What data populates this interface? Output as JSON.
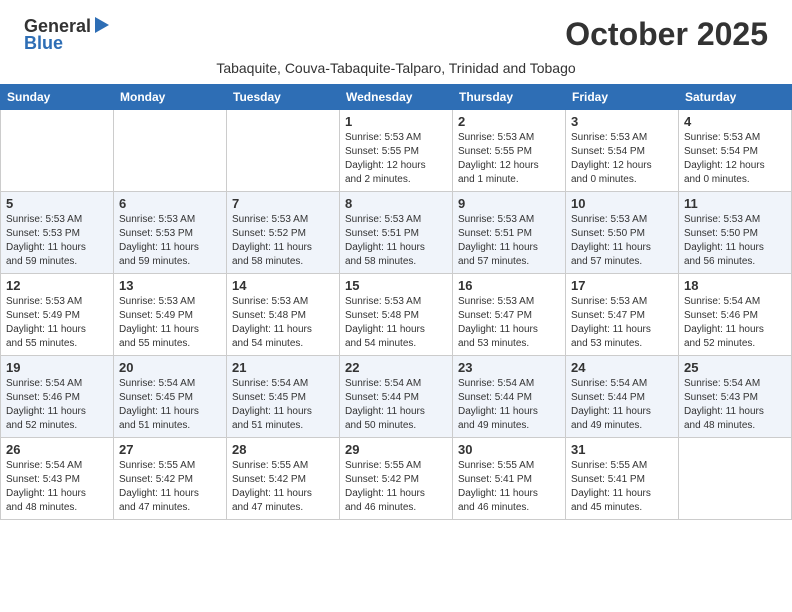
{
  "logo": {
    "general": "General",
    "blue": "Blue",
    "triangle": "▶"
  },
  "title": "October 2025",
  "subtitle": "Tabaquite, Couva-Tabaquite-Talparo, Trinidad and Tobago",
  "days_of_week": [
    "Sunday",
    "Monday",
    "Tuesday",
    "Wednesday",
    "Thursday",
    "Friday",
    "Saturday"
  ],
  "weeks": [
    {
      "cells": [
        {
          "day": "",
          "info": ""
        },
        {
          "day": "",
          "info": ""
        },
        {
          "day": "",
          "info": ""
        },
        {
          "day": "1",
          "info": "Sunrise: 5:53 AM\nSunset: 5:55 PM\nDaylight: 12 hours\nand 2 minutes."
        },
        {
          "day": "2",
          "info": "Sunrise: 5:53 AM\nSunset: 5:55 PM\nDaylight: 12 hours\nand 1 minute."
        },
        {
          "day": "3",
          "info": "Sunrise: 5:53 AM\nSunset: 5:54 PM\nDaylight: 12 hours\nand 0 minutes."
        },
        {
          "day": "4",
          "info": "Sunrise: 5:53 AM\nSunset: 5:54 PM\nDaylight: 12 hours\nand 0 minutes."
        }
      ]
    },
    {
      "cells": [
        {
          "day": "5",
          "info": "Sunrise: 5:53 AM\nSunset: 5:53 PM\nDaylight: 11 hours\nand 59 minutes."
        },
        {
          "day": "6",
          "info": "Sunrise: 5:53 AM\nSunset: 5:53 PM\nDaylight: 11 hours\nand 59 minutes."
        },
        {
          "day": "7",
          "info": "Sunrise: 5:53 AM\nSunset: 5:52 PM\nDaylight: 11 hours\nand 58 minutes."
        },
        {
          "day": "8",
          "info": "Sunrise: 5:53 AM\nSunset: 5:51 PM\nDaylight: 11 hours\nand 58 minutes."
        },
        {
          "day": "9",
          "info": "Sunrise: 5:53 AM\nSunset: 5:51 PM\nDaylight: 11 hours\nand 57 minutes."
        },
        {
          "day": "10",
          "info": "Sunrise: 5:53 AM\nSunset: 5:50 PM\nDaylight: 11 hours\nand 57 minutes."
        },
        {
          "day": "11",
          "info": "Sunrise: 5:53 AM\nSunset: 5:50 PM\nDaylight: 11 hours\nand 56 minutes."
        }
      ]
    },
    {
      "cells": [
        {
          "day": "12",
          "info": "Sunrise: 5:53 AM\nSunset: 5:49 PM\nDaylight: 11 hours\nand 55 minutes."
        },
        {
          "day": "13",
          "info": "Sunrise: 5:53 AM\nSunset: 5:49 PM\nDaylight: 11 hours\nand 55 minutes."
        },
        {
          "day": "14",
          "info": "Sunrise: 5:53 AM\nSunset: 5:48 PM\nDaylight: 11 hours\nand 54 minutes."
        },
        {
          "day": "15",
          "info": "Sunrise: 5:53 AM\nSunset: 5:48 PM\nDaylight: 11 hours\nand 54 minutes."
        },
        {
          "day": "16",
          "info": "Sunrise: 5:53 AM\nSunset: 5:47 PM\nDaylight: 11 hours\nand 53 minutes."
        },
        {
          "day": "17",
          "info": "Sunrise: 5:53 AM\nSunset: 5:47 PM\nDaylight: 11 hours\nand 53 minutes."
        },
        {
          "day": "18",
          "info": "Sunrise: 5:54 AM\nSunset: 5:46 PM\nDaylight: 11 hours\nand 52 minutes."
        }
      ]
    },
    {
      "cells": [
        {
          "day": "19",
          "info": "Sunrise: 5:54 AM\nSunset: 5:46 PM\nDaylight: 11 hours\nand 52 minutes."
        },
        {
          "day": "20",
          "info": "Sunrise: 5:54 AM\nSunset: 5:45 PM\nDaylight: 11 hours\nand 51 minutes."
        },
        {
          "day": "21",
          "info": "Sunrise: 5:54 AM\nSunset: 5:45 PM\nDaylight: 11 hours\nand 51 minutes."
        },
        {
          "day": "22",
          "info": "Sunrise: 5:54 AM\nSunset: 5:44 PM\nDaylight: 11 hours\nand 50 minutes."
        },
        {
          "day": "23",
          "info": "Sunrise: 5:54 AM\nSunset: 5:44 PM\nDaylight: 11 hours\nand 49 minutes."
        },
        {
          "day": "24",
          "info": "Sunrise: 5:54 AM\nSunset: 5:44 PM\nDaylight: 11 hours\nand 49 minutes."
        },
        {
          "day": "25",
          "info": "Sunrise: 5:54 AM\nSunset: 5:43 PM\nDaylight: 11 hours\nand 48 minutes."
        }
      ]
    },
    {
      "cells": [
        {
          "day": "26",
          "info": "Sunrise: 5:54 AM\nSunset: 5:43 PM\nDaylight: 11 hours\nand 48 minutes."
        },
        {
          "day": "27",
          "info": "Sunrise: 5:55 AM\nSunset: 5:42 PM\nDaylight: 11 hours\nand 47 minutes."
        },
        {
          "day": "28",
          "info": "Sunrise: 5:55 AM\nSunset: 5:42 PM\nDaylight: 11 hours\nand 47 minutes."
        },
        {
          "day": "29",
          "info": "Sunrise: 5:55 AM\nSunset: 5:42 PM\nDaylight: 11 hours\nand 46 minutes."
        },
        {
          "day": "30",
          "info": "Sunrise: 5:55 AM\nSunset: 5:41 PM\nDaylight: 11 hours\nand 46 minutes."
        },
        {
          "day": "31",
          "info": "Sunrise: 5:55 AM\nSunset: 5:41 PM\nDaylight: 11 hours\nand 45 minutes."
        },
        {
          "day": "",
          "info": ""
        }
      ]
    }
  ]
}
